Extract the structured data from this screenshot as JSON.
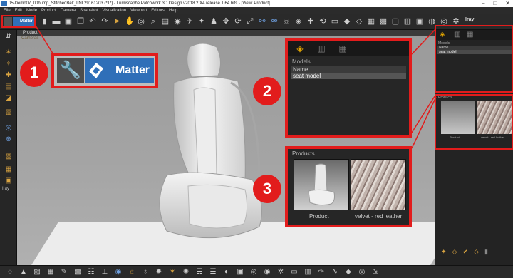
{
  "window": {
    "title": "05-Demo07_00bump_StitchedBelt_LNL29161203 (*1*) - Lumiscaphe Patchwork 3D Design v2018.2 X4 release 1 64 bits - [View: Product]",
    "controls": [
      "–",
      "□",
      "✕"
    ]
  },
  "menu": [
    "File",
    "Edit",
    "Mode",
    "Product",
    "Camera",
    "Snapshot",
    "Visualization",
    "Viewport",
    "Editors",
    "Help"
  ],
  "toolbar": {
    "matter_label": "Matter",
    "iray_label": "Iray"
  },
  "viewport": {
    "tab_label": "Product",
    "sub_label": "Cameras"
  },
  "left_toolbar": {
    "iray_label": "Iray"
  },
  "right_panel": {
    "models_label": "Models",
    "name_header": "Name",
    "model_row": "seat model",
    "products_label": "Products",
    "product_captions": [
      "Product",
      "velvet - red leather"
    ]
  },
  "callouts": {
    "matter_label": "Matter",
    "models_label": "Models",
    "name_header": "Name",
    "model_row": "seat model",
    "products_label": "Products",
    "product_captions": [
      "Product",
      "velvet - red leather"
    ],
    "badges": [
      "1",
      "2",
      "3"
    ]
  },
  "colors": {
    "accent_red": "#e21c1c",
    "matter_blue": "#2f6fb8",
    "icon_orange": "#d9a441"
  }
}
